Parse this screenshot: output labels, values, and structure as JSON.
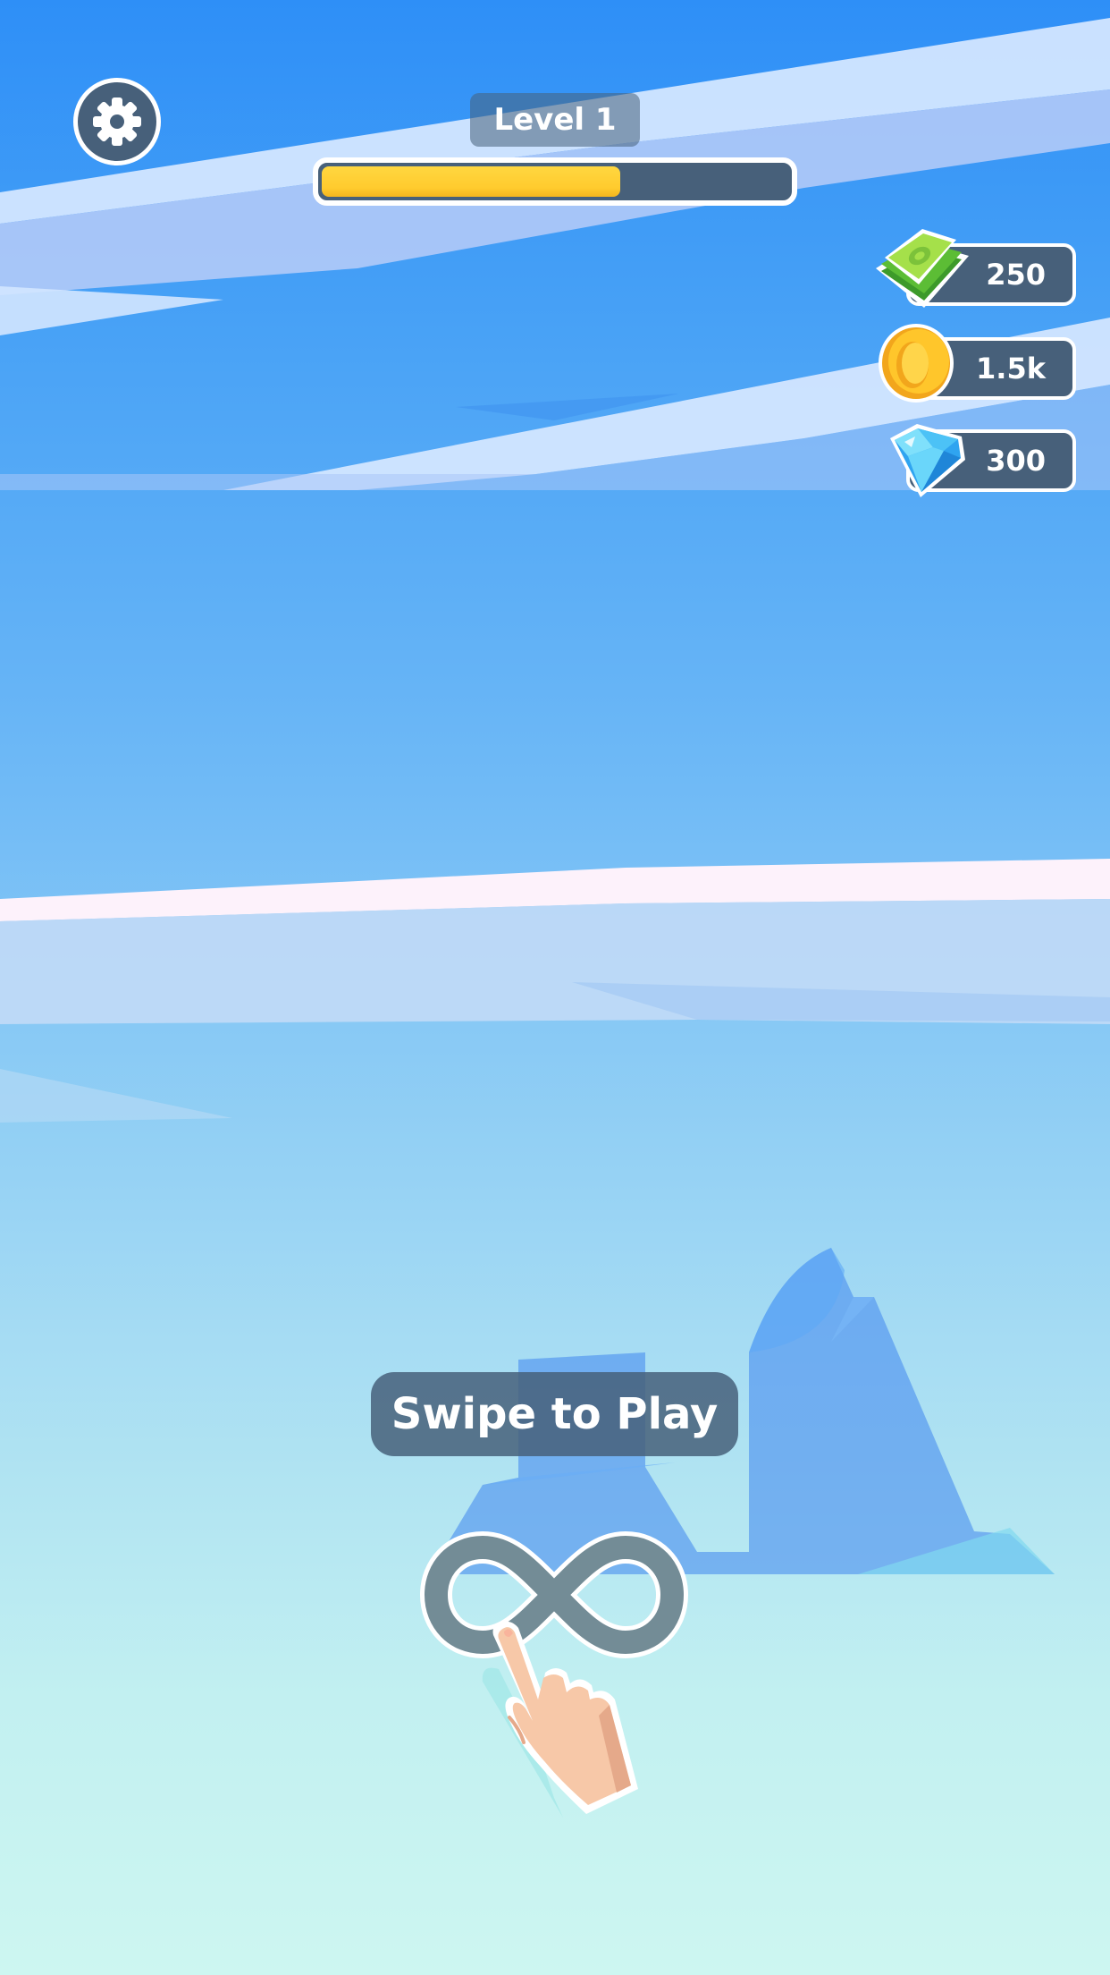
{
  "hud": {
    "level_label": "Level 1",
    "level_progress": 0.64,
    "settings_icon": "gear-icon"
  },
  "currencies": {
    "cash": {
      "icon": "cash-stack-icon",
      "amount": "250"
    },
    "coins": {
      "icon": "gold-coin-icon",
      "amount": "1.5k"
    },
    "gems": {
      "icon": "blue-diamond-icon",
      "amount": "300"
    }
  },
  "tutorial": {
    "prompt": "Swipe to Play",
    "gesture_icon": "infinity-swipe-icon",
    "hand_icon": "pointing-hand-icon"
  },
  "colors": {
    "panel": "#47607a",
    "progress_fill": "#ffcb2e",
    "sky_top": "#2e8ff7",
    "sky_bottom": "#cdf6f1"
  }
}
